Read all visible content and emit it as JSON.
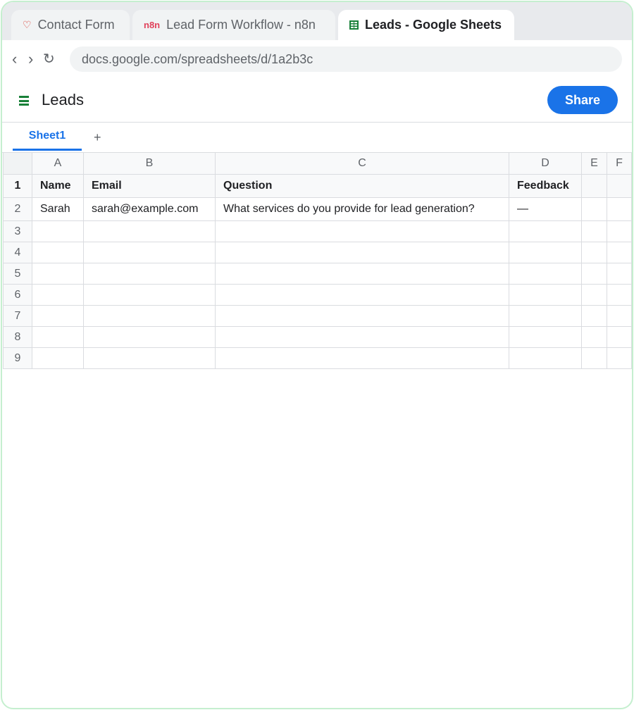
{
  "browser": {
    "tabs": [
      {
        "label": "Contact Form",
        "icon": "heart-icon",
        "active": false
      },
      {
        "label": "Lead Form Workflow - n8n",
        "icon": "n8n-logo-icon",
        "icon_text": "n8n",
        "active": false
      },
      {
        "label": "Leads - Google Sheets",
        "icon": "sheets-icon",
        "active": true
      }
    ],
    "nav": {
      "back": "‹",
      "forward": "›",
      "reload": "↻"
    },
    "url": "docs.google.com/spreadsheets/d/1a2b3c"
  },
  "header": {
    "title": "Leads",
    "share_label": "Share",
    "accent_color": "#1a73e8",
    "sheets_green": "#188038"
  },
  "sheet_tabs": {
    "tabs": [
      "Sheet1"
    ],
    "add_label": "+"
  },
  "grid": {
    "columns": [
      "A",
      "B",
      "C",
      "D",
      "E",
      "F"
    ],
    "rows": [
      {
        "num": "1",
        "cells": [
          "Name",
          "Email",
          "Question",
          "Feedback",
          "",
          ""
        ]
      },
      {
        "num": "2",
        "cells": [
          "Sarah",
          "sarah@example.com",
          "What services do you provide for lead generation?",
          "—",
          "",
          ""
        ]
      },
      {
        "num": "3",
        "cells": [
          "",
          "",
          "",
          "",
          "",
          ""
        ]
      },
      {
        "num": "4",
        "cells": [
          "",
          "",
          "",
          "",
          "",
          ""
        ]
      },
      {
        "num": "5",
        "cells": [
          "",
          "",
          "",
          "",
          "",
          ""
        ]
      },
      {
        "num": "6",
        "cells": [
          "",
          "",
          "",
          "",
          "",
          ""
        ]
      },
      {
        "num": "7",
        "cells": [
          "",
          "",
          "",
          "",
          "",
          ""
        ]
      },
      {
        "num": "8",
        "cells": [
          "",
          "",
          "",
          "",
          "",
          ""
        ]
      },
      {
        "num": "9",
        "cells": [
          "",
          "",
          "",
          "",
          "",
          ""
        ]
      }
    ]
  }
}
